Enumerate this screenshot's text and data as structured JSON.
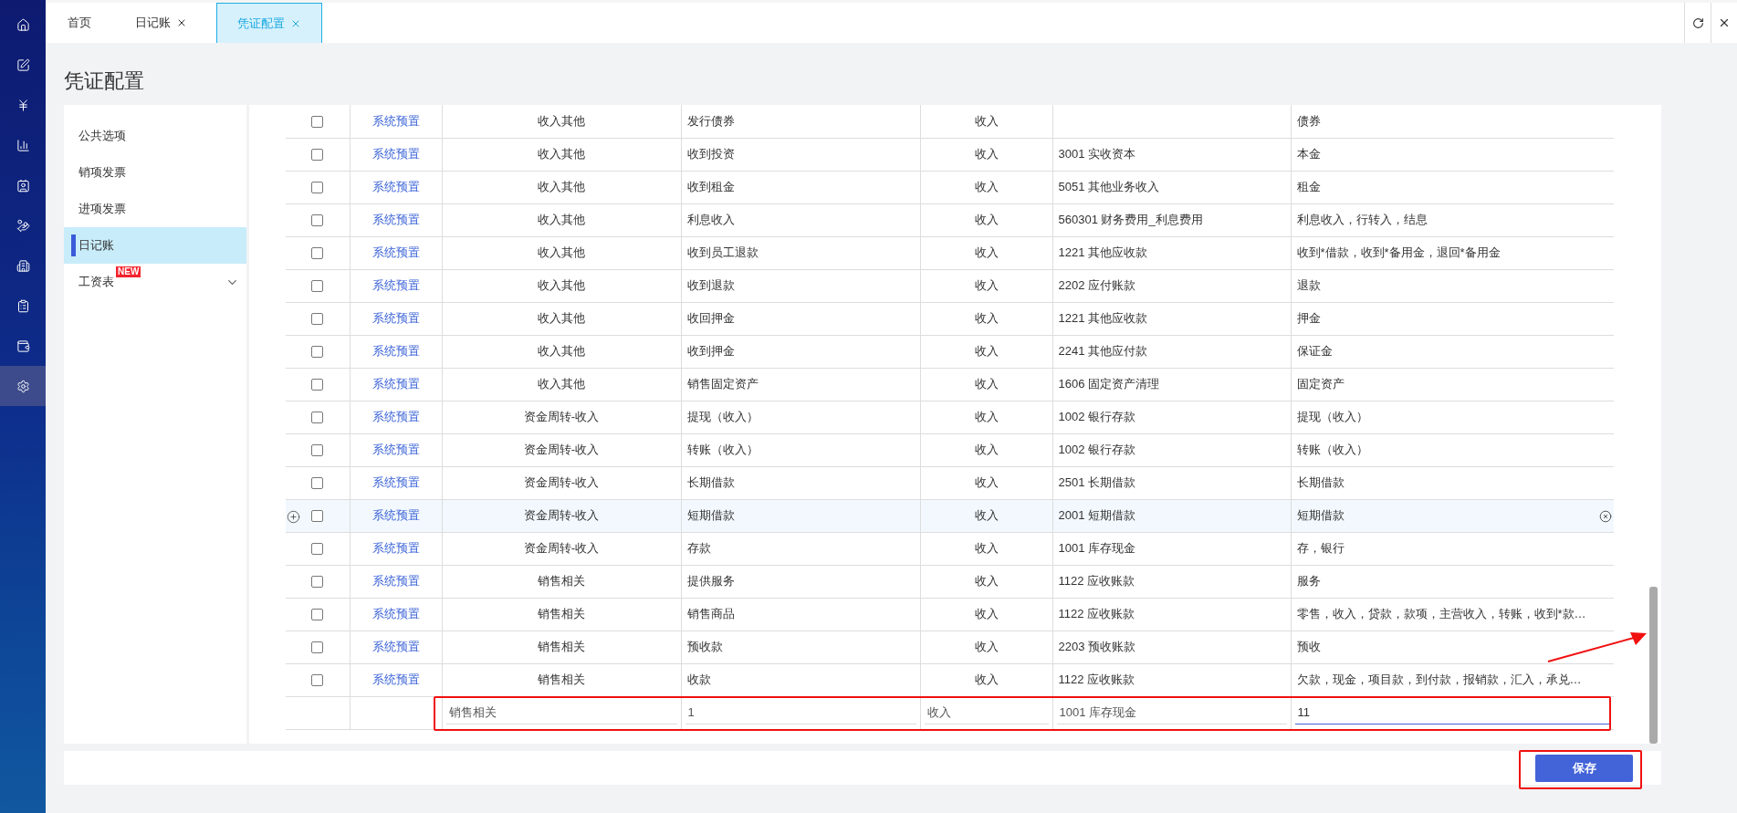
{
  "nav_rail": [
    {
      "kind": "home",
      "selected": false
    },
    {
      "kind": "edit",
      "selected": false
    },
    {
      "kind": "yen",
      "selected": false
    },
    {
      "kind": "chart",
      "selected": false
    },
    {
      "kind": "contact",
      "selected": false
    },
    {
      "kind": "coins",
      "selected": false
    },
    {
      "kind": "building",
      "selected": false
    },
    {
      "kind": "clipboard",
      "selected": false
    },
    {
      "kind": "wallet",
      "selected": false
    },
    {
      "kind": "settings",
      "selected": true
    }
  ],
  "tabs": [
    {
      "label": "首页",
      "closable": false,
      "selected": false
    },
    {
      "label": "日记账",
      "closable": true,
      "selected": false
    },
    {
      "label": "凭证配置",
      "closable": true,
      "selected": true
    }
  ],
  "page_title": "凭证配置",
  "side_menu": [
    {
      "label": "公共选项",
      "selected": false
    },
    {
      "label": "销项发票",
      "selected": false
    },
    {
      "label": "进项发票",
      "selected": false
    },
    {
      "label": "日记账",
      "selected": true
    },
    {
      "label": "工资表",
      "selected": false,
      "badge": "NEW",
      "expanded": false
    }
  ],
  "table": {
    "rows": [
      {
        "checked": false,
        "source": "系统预置",
        "category": "收入其他",
        "name": "发行债券",
        "direction": "收入",
        "subject": "",
        "keywords": "债券",
        "hovered": false
      },
      {
        "checked": false,
        "source": "系统预置",
        "category": "收入其他",
        "name": "收到投资",
        "direction": "收入",
        "subject": "3001 实收资本",
        "keywords": "本金",
        "hovered": false
      },
      {
        "checked": false,
        "source": "系统预置",
        "category": "收入其他",
        "name": "收到租金",
        "direction": "收入",
        "subject": "5051 其他业务收入",
        "keywords": "租金",
        "hovered": false
      },
      {
        "checked": false,
        "source": "系统预置",
        "category": "收入其他",
        "name": "利息收入",
        "direction": "收入",
        "subject": "560301 财务费用_利息费用",
        "keywords": "利息收入，行转入，结息",
        "hovered": false
      },
      {
        "checked": false,
        "source": "系统预置",
        "category": "收入其他",
        "name": "收到员工退款",
        "direction": "收入",
        "subject": "1221 其他应收款",
        "keywords": "收到*借款，收到*备用金，退回*备用金",
        "hovered": false
      },
      {
        "checked": false,
        "source": "系统预置",
        "category": "收入其他",
        "name": "收到退款",
        "direction": "收入",
        "subject": "2202 应付账款",
        "keywords": "退款",
        "hovered": false
      },
      {
        "checked": false,
        "source": "系统预置",
        "category": "收入其他",
        "name": "收回押金",
        "direction": "收入",
        "subject": "1221 其他应收款",
        "keywords": "押金",
        "hovered": false
      },
      {
        "checked": false,
        "source": "系统预置",
        "category": "收入其他",
        "name": "收到押金",
        "direction": "收入",
        "subject": "2241 其他应付款",
        "keywords": "保证金",
        "hovered": false
      },
      {
        "checked": false,
        "source": "系统预置",
        "category": "收入其他",
        "name": "销售固定资产",
        "direction": "收入",
        "subject": "1606 固定资产清理",
        "keywords": "固定资产",
        "hovered": false
      },
      {
        "checked": false,
        "source": "系统预置",
        "category": "资金周转-收入",
        "name": "提现（收入）",
        "direction": "收入",
        "subject": "1002 银行存款",
        "keywords": "提现（收入）",
        "hovered": false
      },
      {
        "checked": false,
        "source": "系统预置",
        "category": "资金周转-收入",
        "name": "转账（收入）",
        "direction": "收入",
        "subject": "1002 银行存款",
        "keywords": "转账（收入）",
        "hovered": false
      },
      {
        "checked": false,
        "source": "系统预置",
        "category": "资金周转-收入",
        "name": "长期借款",
        "direction": "收入",
        "subject": "2501 长期借款",
        "keywords": "长期借款",
        "hovered": false
      },
      {
        "checked": false,
        "source": "系统预置",
        "category": "资金周转-收入",
        "name": "短期借款",
        "direction": "收入",
        "subject": "2001 短期借款",
        "keywords": "短期借款",
        "hovered": true
      },
      {
        "checked": false,
        "source": "系统预置",
        "category": "资金周转-收入",
        "name": "存款",
        "direction": "收入",
        "subject": "1001 库存现金",
        "keywords": "存，银行",
        "hovered": false
      },
      {
        "checked": false,
        "source": "系统预置",
        "category": "销售相关",
        "name": "提供服务",
        "direction": "收入",
        "subject": "1122 应收账款",
        "keywords": "服务",
        "hovered": false
      },
      {
        "checked": false,
        "source": "系统预置",
        "category": "销售相关",
        "name": "销售商品",
        "direction": "收入",
        "subject": "1122 应收账款",
        "keywords": "零售，收入，贷款，款项，主营收入，转账，收到*款…",
        "hovered": false
      },
      {
        "checked": false,
        "source": "系统预置",
        "category": "销售相关",
        "name": "预收款",
        "direction": "收入",
        "subject": "2203 预收账款",
        "keywords": "预收",
        "hovered": false
      },
      {
        "checked": false,
        "source": "系统预置",
        "category": "销售相关",
        "name": "收款",
        "direction": "收入",
        "subject": "1122 应收账款",
        "keywords": "欠款，现金，项目款，到付款，报销款，汇入，承兑…",
        "hovered": false
      }
    ],
    "edit_row": {
      "highlighted": true,
      "fields": [
        {
          "value": "销售相关",
          "focused": false
        },
        {
          "value": "1",
          "focused": false
        },
        {
          "value": "收入",
          "focused": false
        },
        {
          "value": "1001 库存现金",
          "focused": false
        },
        {
          "value": "11",
          "focused": true
        }
      ]
    }
  },
  "save_button": {
    "label": "保存",
    "highlighted": true
  }
}
